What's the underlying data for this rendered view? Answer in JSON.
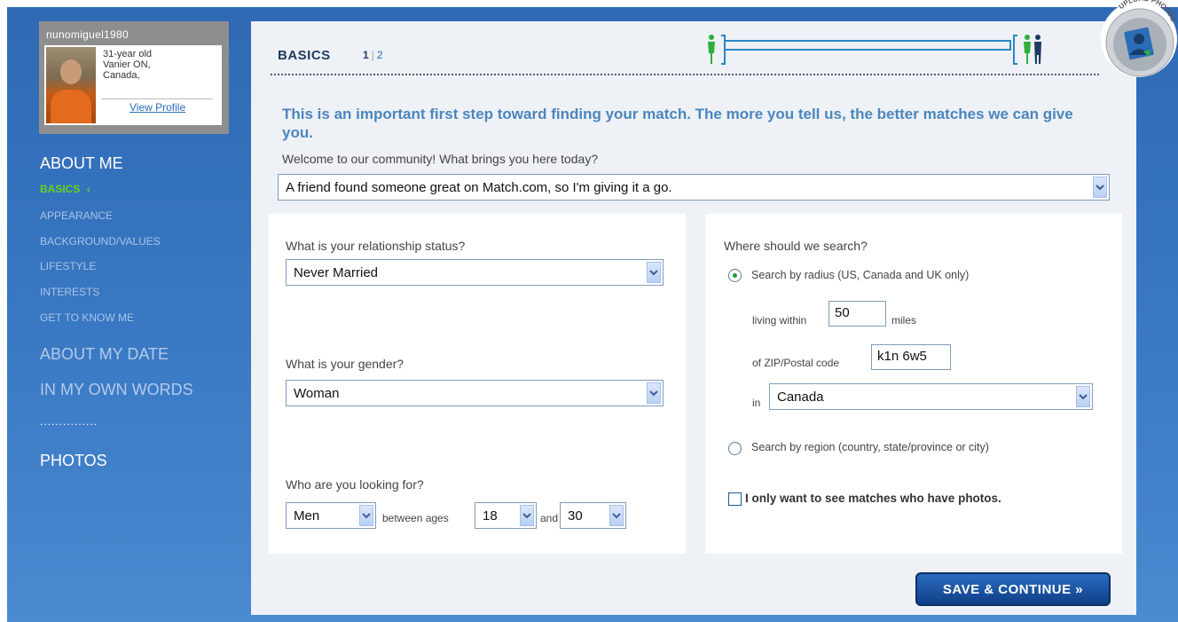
{
  "profile": {
    "username": "nunomiguel1980",
    "age_line": "31-year old",
    "location_line1": "Vanier ON,",
    "location_line2": "Canada,",
    "view_profile": "View Profile"
  },
  "nav": {
    "about_me": "ABOUT ME",
    "basics": "BASICS",
    "appearance": "APPEARANCE",
    "background_values": "BACKGROUND/VALUES",
    "lifestyle": "LIFESTYLE",
    "interests": "INTERESTS",
    "get_to_know_me": "GET TO KNOW ME",
    "about_my_date": "ABOUT MY DATE",
    "in_my_own_words": "IN MY OWN WORDS",
    "dots": "...............",
    "photos": "PHOTOS"
  },
  "header": {
    "title": "BASICS",
    "page_current": "1",
    "page_separator": "|",
    "page_next": "2"
  },
  "upload_badge": {
    "label": "UPLOAD PHOTOS"
  },
  "intro": "This is an important first step toward finding your match. The more you tell us, the better matches we can give you.",
  "welcome": {
    "question": "Welcome to our community! What brings you here today?",
    "value": "A friend found someone great on Match.com, so I'm giving it a go."
  },
  "left_panel": {
    "relationship_q": "What is your relationship status?",
    "relationship_value": "Never Married",
    "gender_q": "What is your gender?",
    "gender_value": "Woman",
    "looking_q": "Who are you looking for?",
    "looking_value": "Men",
    "between_ages": "between ages",
    "age_min": "18",
    "and": "and",
    "age_max": "30"
  },
  "right_panel": {
    "search_q": "Where should we search?",
    "radius_label": "Search by radius (US, Canada and UK only)",
    "radius_selected": true,
    "living_within": "living within",
    "miles_value": "50",
    "miles": "miles",
    "zip_label": "of ZIP/Postal code",
    "zip_value": "k1n 6w5",
    "in": "in",
    "country_value": "Canada",
    "region_label": "Search by region (country, state/province or city)",
    "photos_only_label": "I only want to see matches who have photos.",
    "photos_only_checked": false
  },
  "save_button": "SAVE & CONTINUE »",
  "colors": {
    "background_blue": "#3a79c4",
    "active_nav_green": "#62d321",
    "intro_blue": "#4b86bd",
    "button_navy": "#0e3f86",
    "progress_green": "#2fae3a"
  }
}
